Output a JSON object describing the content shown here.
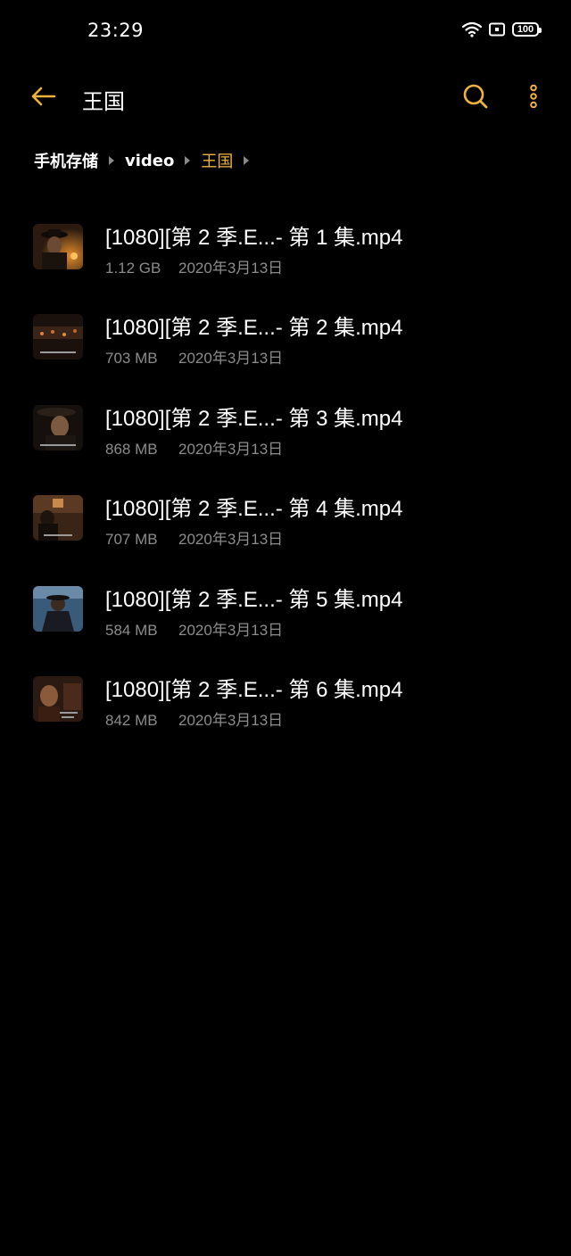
{
  "status_bar": {
    "time": "23:29",
    "battery": "100",
    "icons": [
      "wifi-icon",
      "nfc-icon",
      "battery-icon"
    ]
  },
  "header": {
    "title": "王国",
    "back_icon": "arrow-left-icon",
    "search_icon": "search-icon",
    "more_icon": "more-vertical-icon",
    "accent_color": "#f0b43c"
  },
  "breadcrumb": [
    {
      "label": "手机存储"
    },
    {
      "label": "video"
    },
    {
      "label": "王国"
    }
  ],
  "files": [
    {
      "name": "[1080][第 2 季.E...- 第 1 集.mp4",
      "size": "1.12 GB",
      "date": "2020年3月13日",
      "thumb_icon": "video-thumbnail"
    },
    {
      "name": "[1080][第 2 季.E...- 第 2 集.mp4",
      "size": "703 MB",
      "date": "2020年3月13日",
      "thumb_icon": "video-thumbnail"
    },
    {
      "name": "[1080][第 2 季.E...- 第 3 集.mp4",
      "size": "868 MB",
      "date": "2020年3月13日",
      "thumb_icon": "video-thumbnail"
    },
    {
      "name": "[1080][第 2 季.E...- 第 4 集.mp4",
      "size": "707 MB",
      "date": "2020年3月13日",
      "thumb_icon": "video-thumbnail"
    },
    {
      "name": "[1080][第 2 季.E...- 第 5 集.mp4",
      "size": "584 MB",
      "date": "2020年3月13日",
      "thumb_icon": "video-thumbnail"
    },
    {
      "name": "[1080][第 2 季.E...- 第 6 集.mp4",
      "size": "842 MB",
      "date": "2020年3月13日",
      "thumb_icon": "video-thumbnail"
    }
  ]
}
